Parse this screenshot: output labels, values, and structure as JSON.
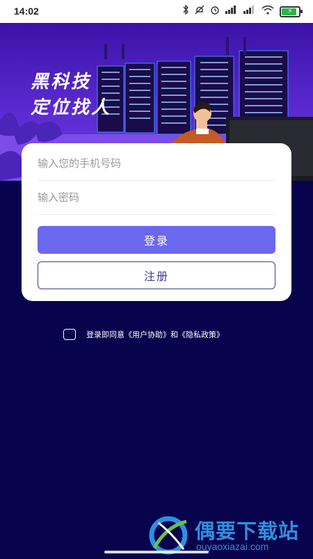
{
  "status_bar": {
    "time": "14:02",
    "icons": [
      "bluetooth-icon",
      "mute-icon",
      "alarm-icon",
      "signal-icon",
      "signal-icon",
      "wifi-icon",
      "battery-icon"
    ]
  },
  "hero": {
    "title_line1": "黑科技",
    "title_line2": "定位找人"
  },
  "login": {
    "phone_placeholder": "输入您的手机号码",
    "password_placeholder": "输入密码",
    "login_label": "登录",
    "register_label": "注册"
  },
  "agreement": {
    "text": "登录即同意《用户协助》和《隐私政策》",
    "checked": false
  },
  "watermark": {
    "name": "偶要下载站",
    "url": "ouyaoxiazai.com"
  },
  "colors": {
    "background": "#07034d",
    "primary_button": "#6a68ee",
    "register_border": "#3b3d8f",
    "hero_top": "#3b12a8"
  }
}
